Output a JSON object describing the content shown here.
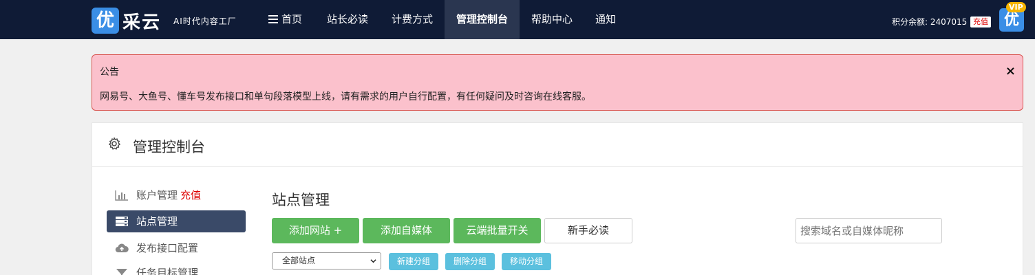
{
  "header": {
    "logo_glyph": "优",
    "logo_text": "采云",
    "logo_subtitle": "AI时代内容工厂",
    "nav": [
      {
        "label": "首页"
      },
      {
        "label": "站长必读"
      },
      {
        "label": "计费方式"
      },
      {
        "label": "管理控制台"
      },
      {
        "label": "帮助中心"
      },
      {
        "label": "通知"
      }
    ],
    "credit_text": "积分余额: 2407015",
    "recharge_label": "充值",
    "avatar_glyph": "优",
    "vip_label": "VIP"
  },
  "notice": {
    "title": "公告",
    "body": "网易号、大鱼号、懂车号发布接口和单句段落模型上线，请有需求的用户自行配置，有任何疑问及时咨询在线客服。",
    "close_glyph": "×"
  },
  "panel": {
    "title": "管理控制台",
    "sidebar": [
      {
        "label": "账户管理",
        "extra": "充值",
        "icon": "bar-chart-icon"
      },
      {
        "label": "站点管理",
        "extra": "",
        "icon": "server-icon"
      },
      {
        "label": "发布接口配置",
        "extra": "",
        "icon": "cloud-upload-icon"
      },
      {
        "label": "任务目标管理",
        "extra": "",
        "icon": "funnel-icon"
      }
    ],
    "section_title": "站点管理",
    "buttons": {
      "add_site": "添加网站 +",
      "add_media": "添加自媒体",
      "cloud_toggle": "云端批量开关",
      "guide": "新手必读"
    },
    "search": {
      "placeholder": "搜索域名或自媒体昵称",
      "value": ""
    },
    "group_select": {
      "selected": "全部站点"
    },
    "group_buttons": {
      "new_group": "新建分组",
      "delete_group": "删除分组",
      "move_group": "移动分组"
    }
  },
  "colors": {
    "nav_bg": "#0f1b36",
    "notice_bg": "#fbc1cc",
    "primary_green": "#5cb85c",
    "info_blue": "#5bc0de",
    "sidebar_active": "#3a4a68"
  }
}
